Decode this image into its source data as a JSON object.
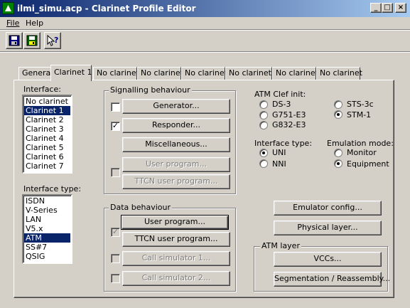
{
  "window": {
    "title": "ilmi_simu.acp - Clarinet Profile Editor",
    "minimize_glyph": "_",
    "maximize_glyph": "□",
    "close_glyph": "×"
  },
  "menu": {
    "file": "File",
    "help": "Help"
  },
  "toolbar": {
    "icons": [
      "save-icon",
      "save-as-icon",
      "context-help-icon"
    ]
  },
  "tabs": [
    "General",
    "Clarinet 1",
    "No clarinet",
    "No clarinet",
    "No clarinet",
    "No clarinet",
    "No clarinet",
    "No clarinet"
  ],
  "active_tab": "Clarinet 1",
  "interface": {
    "label": "Interface:",
    "items": [
      "No clarinet",
      "Clarinet 1",
      "Clarinet 2",
      "Clarinet 3",
      "Clarinet 4",
      "Clarinet 5",
      "Clarinet 6",
      "Clarinet 7"
    ],
    "selected": "Clarinet 1"
  },
  "interface_type": {
    "label": "Interface type:",
    "items": [
      "ISDN",
      "V-Series",
      "LAN",
      "V5.x",
      "ATM",
      "SS#7",
      "QSIG"
    ],
    "selected": "ATM"
  },
  "signalling": {
    "title": "Signalling behaviour",
    "generator": "Generator...",
    "responder": "Responder...",
    "miscellaneous": "Miscellaneous...",
    "user_program": "User program...",
    "ttcn_user_program": "TTCN user program...",
    "generator_checked": false,
    "responder_checked": true,
    "user_program_checked": false
  },
  "data_behaviour": {
    "title": "Data behaviour",
    "user_program": "User program...",
    "ttcn_user_program": "TTCN user program...",
    "call_simulator_1": "Call simulator 1...",
    "call_simulator_2": "Call simulator 2...",
    "user_program_checked": true,
    "call_sim1_checked": false,
    "call_sim2_checked": false
  },
  "atm_clef": {
    "label": "ATM Clef init:",
    "options": [
      "DS-3",
      "G751-E3",
      "G832-E3",
      "STS-3c",
      "STM-1"
    ],
    "selected": "STM-1"
  },
  "iface_type_radio": {
    "label": "Interface type:",
    "options": [
      "UNI",
      "NNI"
    ],
    "selected": "UNI"
  },
  "emulation_mode": {
    "label": "Emulation mode:",
    "options": [
      "Monitor",
      "Equipment"
    ],
    "selected": "Equipment"
  },
  "buttons": {
    "emulator_config": "Emulator config...",
    "physical_layer": "Physical layer..."
  },
  "atm_layer": {
    "title": "ATM layer",
    "vccs": "VCCs...",
    "segmentation": "Segmentation / Reassembly..."
  },
  "colors": {
    "titlebar_start": "#0a246a",
    "titlebar_end": "#a6caf0",
    "selection": "#0a246a",
    "face": "#d4d0c8"
  }
}
